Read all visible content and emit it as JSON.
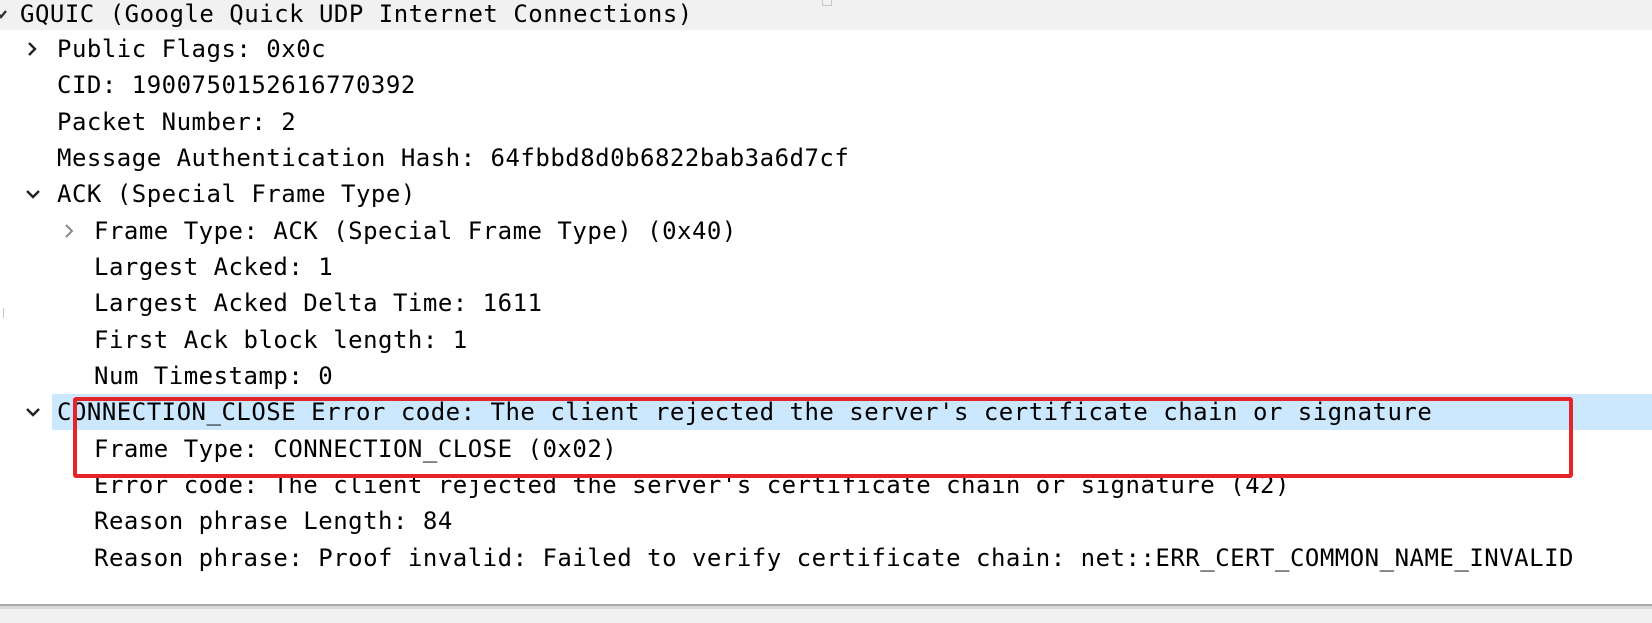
{
  "tree": {
    "root": {
      "label": "GQUIC (Google Quick UDP Internet Connections)",
      "expanded": true,
      "toggle_icon": "chevron-down-icon"
    },
    "rows": [
      {
        "id": "public-flags",
        "label": "Public Flags: 0x0c",
        "expandable": true,
        "expanded": false
      },
      {
        "id": "cid",
        "label": "CID: 1900750152616770392"
      },
      {
        "id": "packet-number",
        "label": "Packet Number: 2"
      },
      {
        "id": "mac-hash",
        "label": "Message Authentication Hash: 64fbbd8d0b6822bab3a6d7cf"
      },
      {
        "id": "ack-frame",
        "label": "ACK (Special Frame Type)",
        "expandable": true,
        "expanded": true
      },
      {
        "id": "ack-frame-type",
        "label": "Frame Type: ACK (Special Frame Type) (0x40)",
        "expandable": true,
        "expanded": false
      },
      {
        "id": "largest-acked",
        "label": "Largest Acked: 1"
      },
      {
        "id": "largest-acked-delta",
        "label": "Largest Acked Delta Time: 1611"
      },
      {
        "id": "first-ack-block",
        "label": "First Ack block length: 1"
      },
      {
        "id": "num-timestamp",
        "label": "Num Timestamp: 0"
      },
      {
        "id": "connection-close",
        "label": "CONNECTION_CLOSE Error code: The client rejected the server's certificate chain or signature",
        "expandable": true,
        "expanded": true,
        "selected": true
      },
      {
        "id": "cc-frame-type",
        "label": "Frame Type: CONNECTION_CLOSE (0x02)"
      },
      {
        "id": "cc-error-code",
        "label": "Error code: The client rejected the server's certificate chain or signature (42)"
      },
      {
        "id": "cc-reason-length",
        "label": "Reason phrase Length: 84"
      },
      {
        "id": "cc-reason-phrase",
        "label": "Reason phrase: Proof invalid: Failed to verify certificate chain: net::ERR_CERT_COMMON_NAME_INVALID"
      }
    ]
  },
  "colors": {
    "selection": "#cce8ff",
    "annotation": "#e5242a",
    "root_band": "#f1f1f1"
  }
}
